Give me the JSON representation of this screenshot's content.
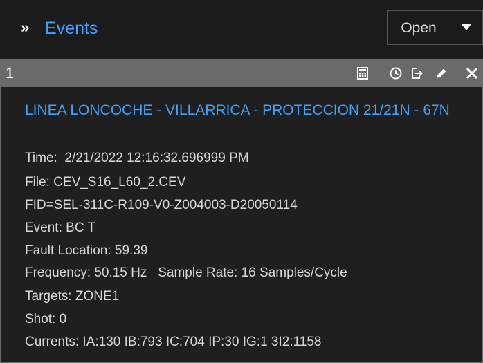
{
  "header": {
    "title": "Events",
    "open_label": "Open",
    "chevron_glyph": "»"
  },
  "panel": {
    "number": "1",
    "tools": [
      "calculator-icon",
      "clock-icon",
      "export-icon",
      "pencil-icon",
      "close-icon"
    ],
    "event_title": "LINEA LONCOCHE - VILLARRICA - PROTECCION 21/21N - 67N",
    "time": "Time:  2/21/2022 12:16:32.696999 PM",
    "file": "File: CEV_S16_L60_2.CEV",
    "fid": "FID=SEL-311C-R109-V0-Z004003-D20050114",
    "event": "Event: BC T",
    "fault_location": "Fault Location: 59.39",
    "frequency": "Frequency: 50.15 Hz   Sample Rate: 16 Samples/Cycle",
    "targets": "Targets: ZONE1",
    "shot": "Shot: 0",
    "currents": "Currents: IA:130 IB:793 IC:704 IP:30 IG:1 3I2:1158"
  },
  "colors": {
    "accent": "#3fa2ff",
    "background": "#1f1f1f",
    "panel_header": "#6a6a6a",
    "text": "#d8d8d8"
  }
}
